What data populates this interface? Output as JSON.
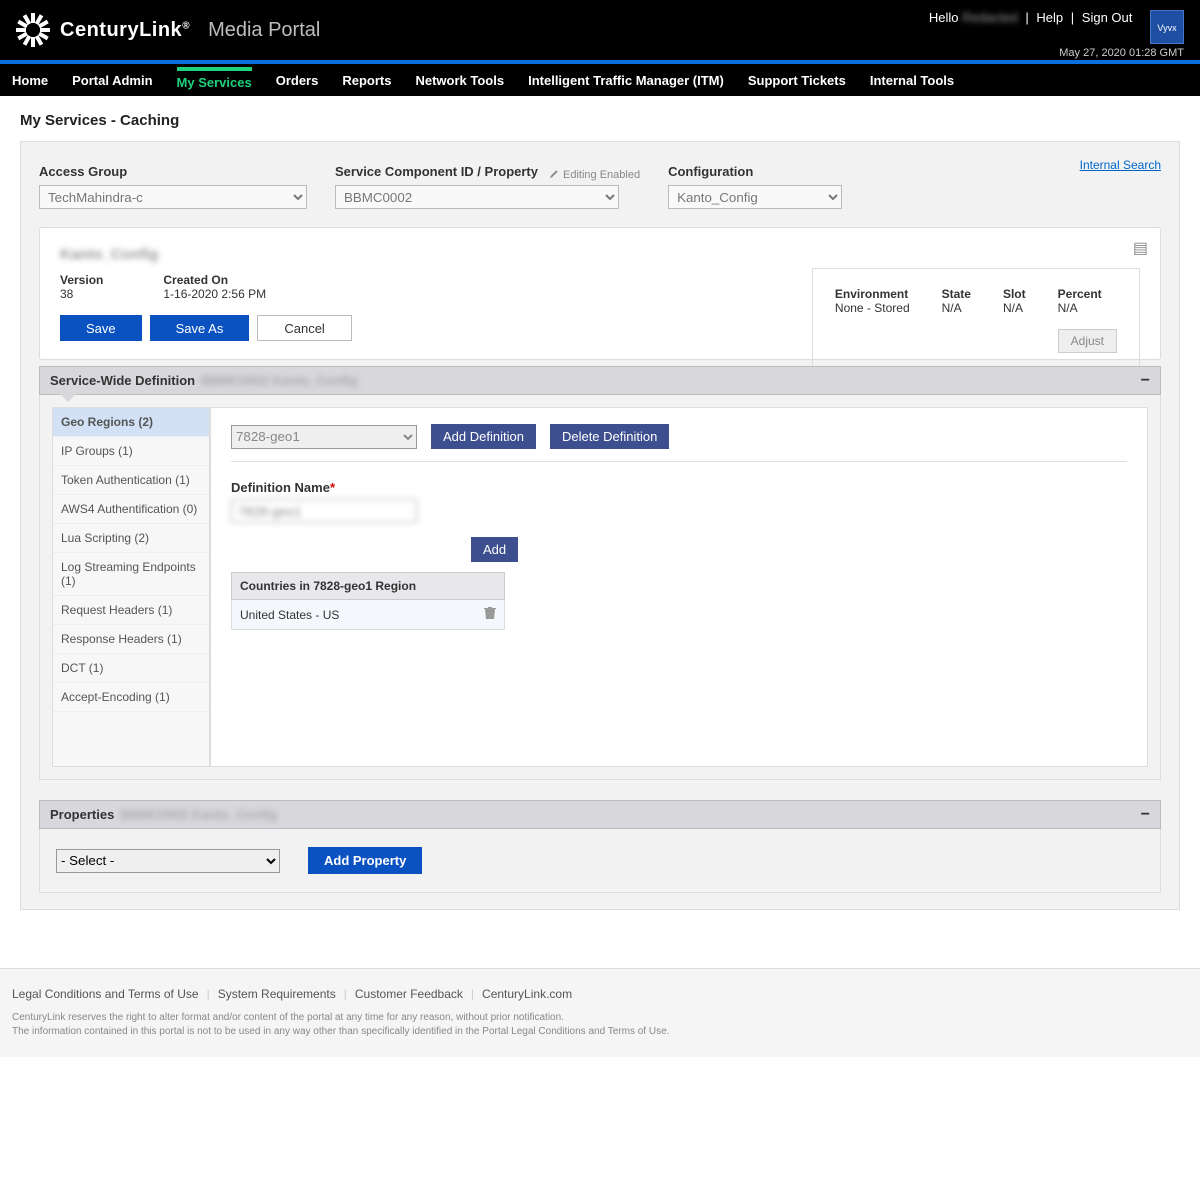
{
  "header": {
    "brand": "CenturyLink",
    "portal": "Media Portal",
    "greeting": "Hello",
    "username": "Redacted",
    "help": "Help",
    "signout": "Sign Out",
    "timestamp": "May 27, 2020 01:28 GMT",
    "badge": "Vyvx"
  },
  "nav": {
    "items": [
      {
        "label": "Home",
        "active": false
      },
      {
        "label": "Portal Admin",
        "active": false
      },
      {
        "label": "My Services",
        "active": true
      },
      {
        "label": "Orders",
        "active": false
      },
      {
        "label": "Reports",
        "active": false
      },
      {
        "label": "Network Tools",
        "active": false
      },
      {
        "label": "Intelligent Traffic Manager (ITM)",
        "active": false
      },
      {
        "label": "Support Tickets",
        "active": false
      },
      {
        "label": "Internal Tools",
        "active": false
      }
    ]
  },
  "page": {
    "title": "My Services - Caching",
    "internal_search": "Internal Search",
    "selectors": {
      "access_group": {
        "label": "Access Group",
        "value": "TechMahindra-c"
      },
      "scid": {
        "label": "Service Component ID / Property",
        "editing": "Editing Enabled",
        "value": "BBMC0002"
      },
      "config": {
        "label": "Configuration",
        "value": "Kanto_Config"
      }
    }
  },
  "config_card": {
    "name": "Kanto_Config",
    "version_label": "Version",
    "version": "38",
    "created_label": "Created On",
    "created": "1-16-2020 2:56 PM",
    "save": "Save",
    "save_as": "Save As",
    "cancel": "Cancel",
    "env": {
      "environment_label": "Environment",
      "environment": "None - Stored",
      "state_label": "State",
      "state": "N/A",
      "slot_label": "Slot",
      "slot": "N/A",
      "percent_label": "Percent",
      "percent": "N/A",
      "adjust": "Adjust"
    }
  },
  "section": {
    "title": "Service-Wide Definition",
    "redacted": "BBMC0002  Kanto_Config",
    "tabs": [
      {
        "label": "Geo Regions (2)",
        "active": true
      },
      {
        "label": "IP Groups (1)"
      },
      {
        "label": "Token Authentication (1)"
      },
      {
        "label": "AWS4 Authentification (0)"
      },
      {
        "label": "Lua Scripting (2)"
      },
      {
        "label": "Log Streaming Endpoints (1)"
      },
      {
        "label": "Request Headers (1)"
      },
      {
        "label": "Response Headers (1)"
      },
      {
        "label": "DCT (1)"
      },
      {
        "label": "Accept-Encoding (1)"
      }
    ],
    "def_select": "7828-geo1",
    "add_def": "Add Definition",
    "del_def": "Delete Definition",
    "def_name_label": "Definition Name",
    "def_name_value": "7828-geo1",
    "add": "Add",
    "countries_header": "Countries in 7828-geo1 Region",
    "country_row": "United States - US"
  },
  "properties": {
    "title": "Properties",
    "redacted": "BBMC0002  Kanto_Config",
    "select": "- Select -",
    "add": "Add Property"
  },
  "footer": {
    "links": [
      "Legal Conditions and Terms of Use",
      "System Requirements",
      "Customer Feedback",
      "CenturyLink.com"
    ],
    "d1": "CenturyLink reserves the right to alter format and/or content of the portal at any time for any reason, without prior notification.",
    "d2": "The information contained in this portal is not to be used in any way other than specifically identified in the Portal Legal Conditions and Terms of Use."
  }
}
